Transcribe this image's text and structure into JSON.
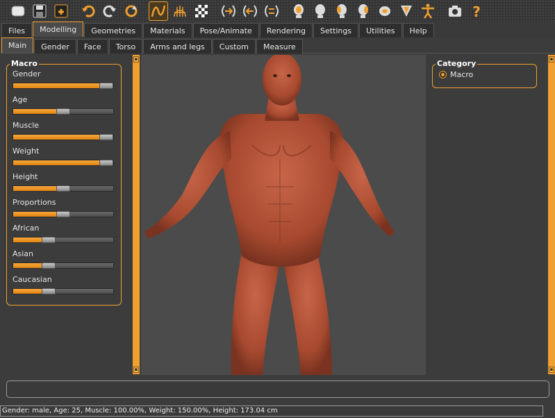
{
  "toolbar": {
    "buttons": [
      {
        "icon": "undo-icon"
      }
    ]
  },
  "main_tabs": [
    "Files",
    "Modelling",
    "Geometries",
    "Materials",
    "Pose/Animate",
    "Rendering",
    "Settings",
    "Utilities",
    "Help"
  ],
  "main_tab_active": "Modelling",
  "sub_tabs": [
    "Main",
    "Gender",
    "Face",
    "Torso",
    "Arms and legs",
    "Custom",
    "Measure"
  ],
  "sub_tab_active": "Main",
  "macro": {
    "title": "Macro",
    "sliders": [
      {
        "label": "Gender",
        "value": 1.0
      },
      {
        "label": "Age",
        "value": 0.5
      },
      {
        "label": "Muscle",
        "value": 1.0
      },
      {
        "label": "Weight",
        "value": 1.0
      },
      {
        "label": "Height",
        "value": 0.5
      },
      {
        "label": "Proportions",
        "value": 0.5
      },
      {
        "label": "African",
        "value": 0.33
      },
      {
        "label": "Asian",
        "value": 0.33
      },
      {
        "label": "Caucasian",
        "value": 0.33
      }
    ]
  },
  "category": {
    "title": "Category",
    "options": [
      "Macro"
    ],
    "selected": "Macro"
  },
  "status": "Gender: male, Age: 25, Muscle: 100.00%, Weight: 150.00%, Height: 173.04 cm",
  "colors": {
    "accent": "#f0a030",
    "skin": "#b5533a"
  }
}
